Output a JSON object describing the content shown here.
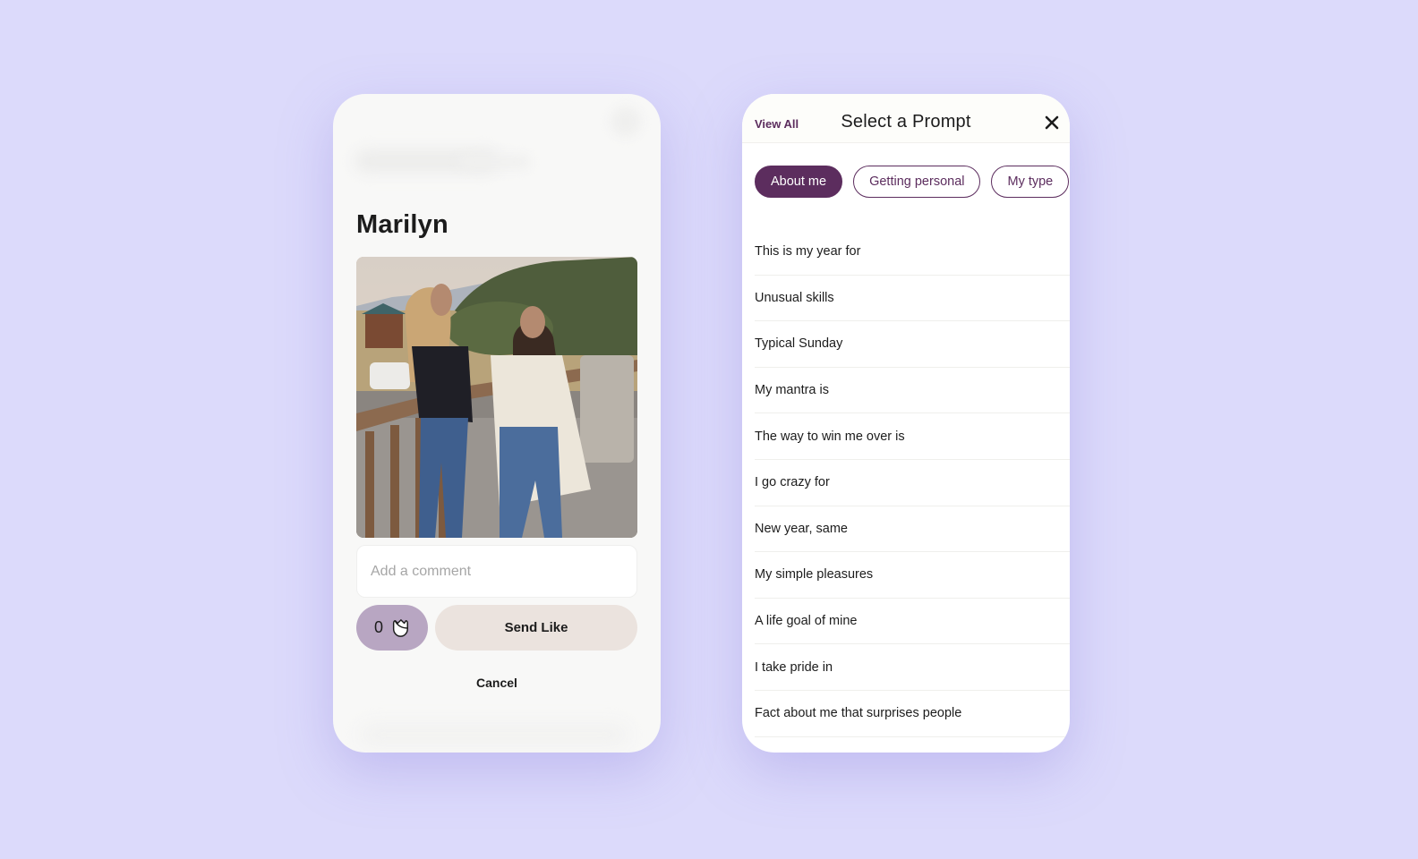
{
  "like_card": {
    "profile_name": "Marilyn",
    "photo_alt": "Two women sitting on a wooden deck railing outdoors",
    "comment": {
      "value": "",
      "placeholder": "Add a comment"
    },
    "rose_count": "0",
    "rose_icon": "rose-icon",
    "send_like_label": "Send Like",
    "cancel_label": "Cancel"
  },
  "prompt_card": {
    "view_all_label": "View All",
    "title": "Select a Prompt",
    "close_icon": "close-icon",
    "categories": [
      {
        "label": "About me",
        "active": true
      },
      {
        "label": "Getting personal",
        "active": false
      },
      {
        "label": "My type",
        "active": false
      }
    ],
    "prompts": [
      "This is my year for",
      "Unusual skills",
      "Typical Sunday",
      "My mantra is",
      "The way to win me over is",
      "I go crazy for",
      "New year, same",
      "My simple pleasures",
      "A life goal of mine",
      "I take pride in",
      "Fact about me that surprises people"
    ]
  },
  "colors": {
    "background": "#dcdafb",
    "accent": "#5c2d5e",
    "rose_button": "#b8a6c2",
    "send_like_button": "#ebe3de"
  }
}
